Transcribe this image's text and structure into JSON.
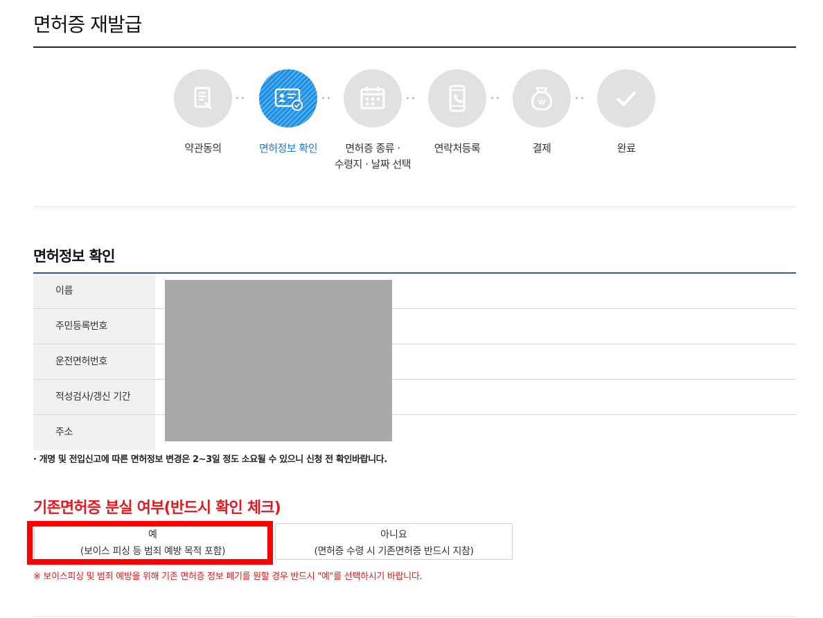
{
  "page_title": "면허증 재발급",
  "steps": [
    {
      "label": "약관동의",
      "icon": "document-pen-icon",
      "active": false
    },
    {
      "label": "면허정보 확인",
      "icon": "id-card-check-icon",
      "active": true
    },
    {
      "label_line1": "면허증 종류 ·",
      "label_line2": "수령지 · 날짜 선택",
      "icon": "calendar-icon",
      "active": false
    },
    {
      "label": "연락처등록",
      "icon": "phone-icon",
      "active": false
    },
    {
      "label": "결제",
      "icon": "money-bag-icon",
      "active": false
    },
    {
      "label": "완료",
      "icon": "check-icon",
      "active": false
    }
  ],
  "info_section": {
    "title": "면허정보 확인",
    "rows": [
      {
        "label": "이름"
      },
      {
        "label": "주민등록번호"
      },
      {
        "label": "운전면허번호"
      },
      {
        "label": "적성검사/갱신 기간"
      },
      {
        "label": "주소"
      }
    ],
    "note": "· 개명 및 전입신고에 따른 면허정보 변경은 2~3일 정도 소요될 수 있으니 신청 전 확인바랍니다."
  },
  "loss_section": {
    "title": "기존면허증 분실 여부(반드시 확인 체크)",
    "yes_button": {
      "line1": "예",
      "line2": "(보이스 피싱 등 범죄 예방 목적 포함)"
    },
    "no_button": {
      "line1": "아니요",
      "line2": "(면허증 수령 시 기존면허증 반드시 지참)"
    },
    "warning": "※ 보이스피싱 및 범죄 예방을 위해 기존 면허증 정보 폐기를 원할 경우 반드시 \"예\"를 선택하시기 바랍니다."
  },
  "colors": {
    "accent_blue": "#1f7ad0",
    "warning_red": "#e5171d",
    "highlight_red": "#ff0000",
    "inactive_circle": "#e1e1e1"
  }
}
